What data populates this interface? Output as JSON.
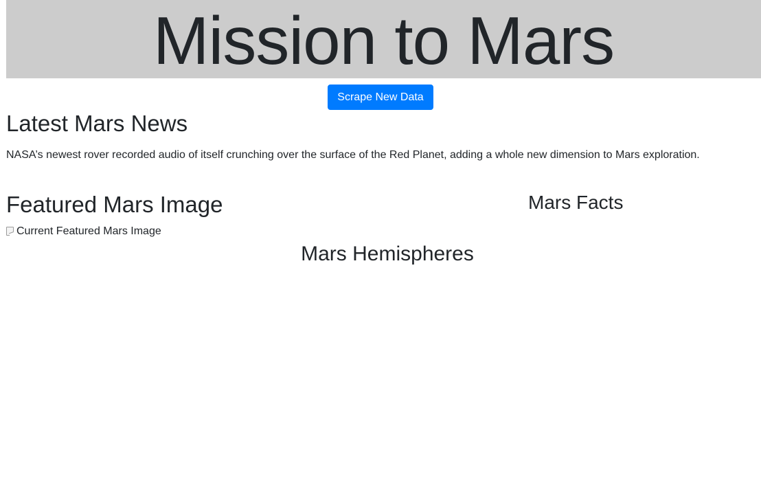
{
  "header": {
    "title": "Mission to Mars"
  },
  "actions": {
    "scrape_label": "Scrape New Data"
  },
  "news": {
    "heading": "Latest Mars News",
    "paragraph": "NASA’s newest rover recorded audio of itself crunching over the surface of the Red Planet, adding a whole new dimension to Mars exploration."
  },
  "featured": {
    "heading": "Featured Mars Image",
    "image_alt": "Current Featured Mars Image"
  },
  "facts": {
    "heading": "Mars Facts"
  },
  "hemispheres": {
    "heading": "Mars Hemispheres"
  },
  "colors": {
    "jumbotron_bg": "#cccccc",
    "primary": "#007bff",
    "text": "#212529"
  },
  "icons": {
    "broken_image": "broken-image-icon"
  }
}
